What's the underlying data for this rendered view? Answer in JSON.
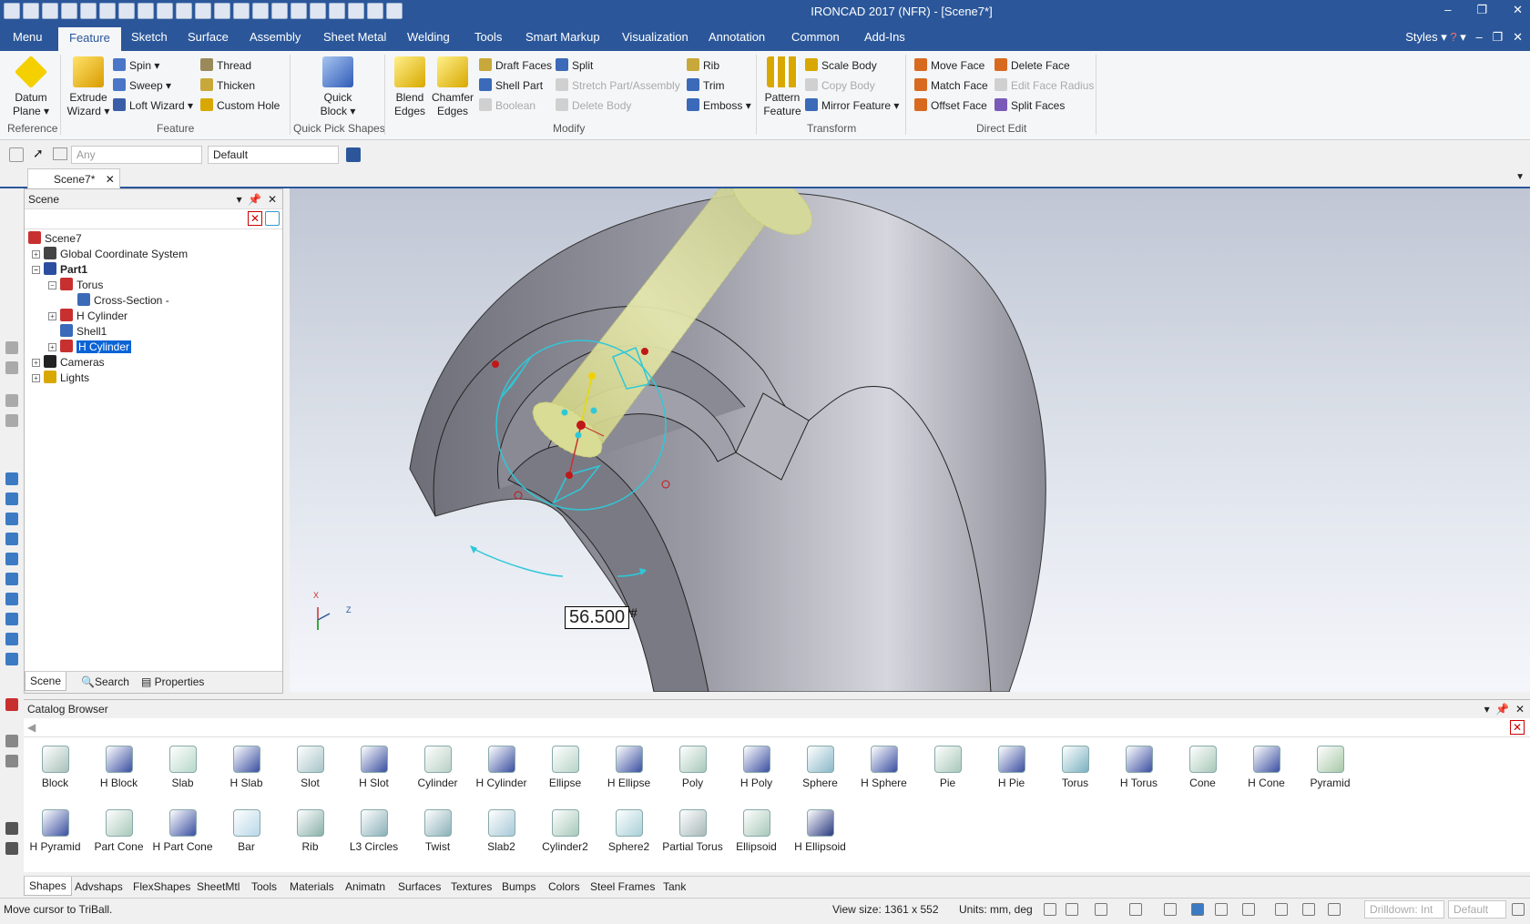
{
  "window": {
    "title": "IRONCAD 2017 (NFR) - [Scene7*]"
  },
  "menu_tabs": [
    "Menu",
    "Feature",
    "Sketch",
    "Surface",
    "Assembly",
    "Sheet Metal",
    "Welding",
    "Tools",
    "Smart Markup",
    "Visualization",
    "Annotation",
    "Common",
    "Add-Ins"
  ],
  "menu_right": {
    "styles": "Styles"
  },
  "ribbon": {
    "datum_plane": "Datum\nPlane",
    "reference": "Reference",
    "extrude_wizard": "Extrude\nWizard",
    "spin": "Spin",
    "sweep": "Sweep",
    "loft_wizard": "Loft Wizard",
    "thread": "Thread",
    "thicken": "Thicken",
    "custom_hole": "Custom Hole",
    "feature": "Feature",
    "quick_block": "Quick\nBlock",
    "quick_pick_shapes": "Quick Pick Shapes",
    "blend_edges": "Blend\nEdges",
    "chamfer_edges": "Chamfer\nEdges",
    "draft_faces": "Draft Faces",
    "shell_part": "Shell Part",
    "boolean": "Boolean",
    "split": "Split",
    "stretch_part": "Stretch Part/Assembly",
    "delete_body": "Delete Body",
    "rib": "Rib",
    "trim": "Trim",
    "emboss": "Emboss",
    "modify": "Modify",
    "pattern_feature": "Pattern\nFeature",
    "scale_body": "Scale Body",
    "copy_body": "Copy Body",
    "mirror_feature": "Mirror Feature",
    "transform": "Transform",
    "move_face": "Move Face",
    "match_face": "Match Face",
    "offset_face": "Offset Face",
    "delete_face": "Delete Face",
    "edit_face_radius": "Edit Face Radius",
    "split_faces": "Split Faces",
    "direct_edit": "Direct Edit"
  },
  "toolbar2": {
    "filter_value": "Any",
    "style_value": "Default"
  },
  "doc_tab": "Scene7*",
  "scene_panel": {
    "title": "Scene",
    "tree": [
      {
        "label": "Scene7",
        "indent": 0,
        "icon": "scene"
      },
      {
        "label": "Global Coordinate System",
        "indent": 1,
        "icon": "axes"
      },
      {
        "label": "Part1",
        "indent": 1,
        "icon": "part"
      },
      {
        "label": "Torus",
        "indent": 2,
        "icon": "torus"
      },
      {
        "label": "Cross-Section -",
        "indent": 3,
        "icon": "sketch"
      },
      {
        "label": "H Cylinder",
        "indent": 2,
        "icon": "cyl"
      },
      {
        "label": "Shell1",
        "indent": 2,
        "icon": "shell"
      },
      {
        "label": "H Cylinder",
        "indent": 2,
        "icon": "cyl",
        "selected": true
      },
      {
        "label": "Cameras",
        "indent": 1,
        "icon": "camera"
      },
      {
        "label": "Lights",
        "indent": 1,
        "icon": "light"
      }
    ],
    "footer_tabs": [
      "Scene",
      "Search",
      "Properties"
    ]
  },
  "viewport": {
    "dimension_value": "56.500",
    "dimension_suffix": "#",
    "axis_x": "X",
    "axis_z": "Z"
  },
  "catalog": {
    "title": "Catalog Browser",
    "items": [
      "Block",
      "H Block",
      "Slab",
      "H Slab",
      "Slot",
      "H Slot",
      "Cylinder",
      "H Cylinder",
      "Ellipse",
      "H Ellipse",
      "Poly",
      "H Poly",
      "Sphere",
      "H Sphere",
      "Pie",
      "H Pie",
      "Torus",
      "H Torus",
      "Cone",
      "H Cone",
      "Pyramid",
      "H Pyramid",
      "Part Cone",
      "H Part Cone",
      "Bar",
      "Rib",
      "L3 Circles",
      "Twist",
      "Slab2",
      "Cylinder2",
      "Sphere2",
      "Partial Torus",
      "Ellipsoid",
      "H Ellipsoid"
    ],
    "tabs": [
      "Shapes",
      "Advshaps",
      "FlexShapes",
      "SheetMtl",
      "Tools",
      "Materials",
      "Animatn",
      "Surfaces",
      "Textures",
      "Bumps",
      "Colors",
      "Steel Frames",
      "Tank"
    ]
  },
  "status": {
    "message": "Move cursor to TriBall.",
    "view_size": "View size: 1361 x  552",
    "units": "Units: mm, deg",
    "drilldown": "Drilldown: Int",
    "default": "Default"
  },
  "colors": {
    "accent": "#2b579a",
    "selection": "#0a64d6",
    "triball": "#2ec8d8",
    "cylinder": "#dde29a"
  }
}
